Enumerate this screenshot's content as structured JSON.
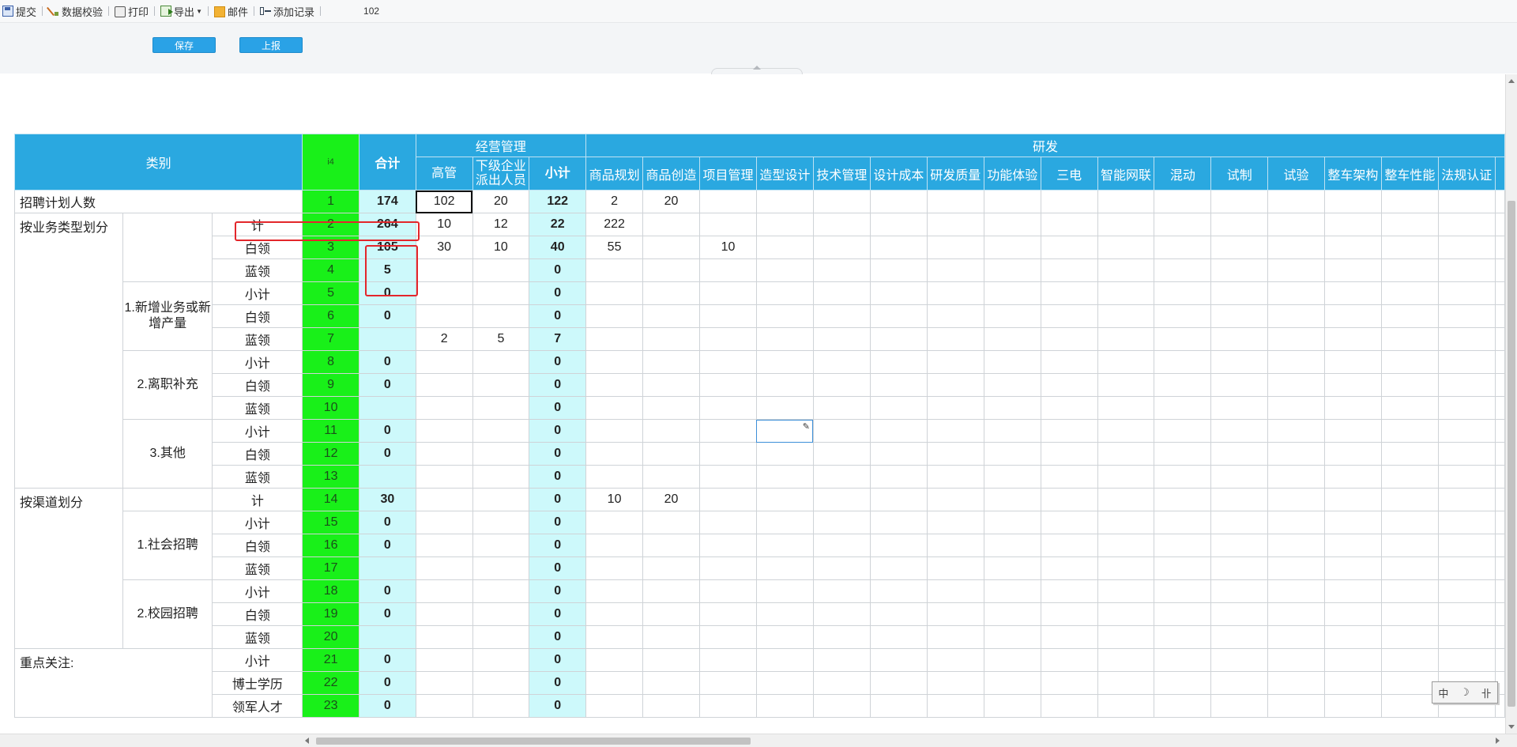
{
  "toolbar": {
    "submit": "提交",
    "validate": "数据校验",
    "print": "打印",
    "export": "导出",
    "mail": "邮件",
    "add_record": "添加记录",
    "record_no": "102"
  },
  "actions": {
    "save": "保存",
    "report": "上报"
  },
  "header": {
    "category": "类别",
    "rowid": "i4",
    "total": "合计",
    "group_mgmt": "经营管理",
    "group_rd": "研发",
    "mgmt_cols": [
      "高管",
      "下级企业派出人员",
      "小计"
    ],
    "rd_cols": [
      "商品规划",
      "商品创造",
      "项目管理",
      "造型设计",
      "技术管理",
      "设计成本",
      "研发质量",
      "功能体验",
      "三电",
      "智能网联",
      "混动",
      "试制",
      "试验",
      "整车架构",
      "整车性能",
      "法规认证"
    ]
  },
  "sections": {
    "plan": "招聘计划人数",
    "by_type": "按业务类型划分",
    "new_biz": "1.新增业务或新增产量",
    "attrition": "2.离职补充",
    "other": "3.其他",
    "by_channel": "按渠道划分",
    "social": "1.社会招聘",
    "campus": "2.校园招聘",
    "focus": "重点关注:"
  },
  "rows": [
    {
      "label": "",
      "no": "1",
      "total": "174",
      "gg": "102",
      "xj": "20",
      "sub": "122",
      "rd": [
        "2",
        "20",
        "",
        "",
        "",
        "",
        "",
        "",
        "",
        "",
        "",
        "",
        "",
        "",
        "",
        ""
      ]
    },
    {
      "label": "计",
      "no": "2",
      "total": "264",
      "gg": "10",
      "xj": "12",
      "sub": "22",
      "rd": [
        "222",
        "",
        "",
        "",
        "",
        "",
        "",
        "",
        "",
        "",
        "",
        "",
        "",
        "",
        "",
        ""
      ]
    },
    {
      "label": "白领",
      "no": "3",
      "total": "105",
      "gg": "30",
      "xj": "10",
      "sub": "40",
      "rd": [
        "55",
        "",
        "10",
        "",
        "",
        "",
        "",
        "",
        "",
        "",
        "",
        "",
        "",
        "",
        "",
        ""
      ]
    },
    {
      "label": "蓝领",
      "no": "4",
      "total": "5",
      "gg": "",
      "xj": "",
      "sub": "0",
      "rd": [
        "",
        "",
        "",
        "",
        "",
        "",
        "",
        "",
        "",
        "",
        "",
        "",
        "",
        "",
        "",
        ""
      ]
    },
    {
      "label": "小计",
      "no": "5",
      "total": "0",
      "gg": "",
      "xj": "",
      "sub": "0",
      "rd": [
        "",
        "",
        "",
        "",
        "",
        "",
        "",
        "",
        "",
        "",
        "",
        "",
        "",
        "",
        "",
        ""
      ]
    },
    {
      "label": "白领",
      "no": "6",
      "total": "0",
      "gg": "",
      "xj": "",
      "sub": "0",
      "rd": [
        "",
        "",
        "",
        "",
        "",
        "",
        "",
        "",
        "",
        "",
        "",
        "",
        "",
        "",
        "",
        ""
      ]
    },
    {
      "label": "蓝领",
      "no": "7",
      "total": "",
      "gg": "2",
      "xj": "5",
      "sub": "7",
      "rd": [
        "",
        "",
        "",
        "",
        "",
        "",
        "",
        "",
        "",
        "",
        "",
        "",
        "",
        "",
        "",
        ""
      ]
    },
    {
      "label": "小计",
      "no": "8",
      "total": "0",
      "gg": "",
      "xj": "",
      "sub": "0",
      "rd": [
        "",
        "",
        "",
        "",
        "",
        "",
        "",
        "",
        "",
        "",
        "",
        "",
        "",
        "",
        "",
        ""
      ]
    },
    {
      "label": "白领",
      "no": "9",
      "total": "0",
      "gg": "",
      "xj": "",
      "sub": "0",
      "rd": [
        "",
        "",
        "",
        "",
        "",
        "",
        "",
        "",
        "",
        "",
        "",
        "",
        "",
        "",
        "",
        ""
      ]
    },
    {
      "label": "蓝领",
      "no": "10",
      "total": "",
      "gg": "",
      "xj": "",
      "sub": "0",
      "rd": [
        "",
        "",
        "",
        "",
        "",
        "",
        "",
        "",
        "",
        "",
        "",
        "",
        "",
        "",
        "",
        ""
      ]
    },
    {
      "label": "小计",
      "no": "11",
      "total": "0",
      "gg": "",
      "xj": "",
      "sub": "0",
      "rd": [
        "",
        "",
        "",
        "",
        "",
        "",
        "",
        "",
        "",
        "",
        "",
        "",
        "",
        "",
        "",
        ""
      ]
    },
    {
      "label": "白领",
      "no": "12",
      "total": "0",
      "gg": "",
      "xj": "",
      "sub": "0",
      "rd": [
        "",
        "",
        "",
        "",
        "",
        "",
        "",
        "",
        "",
        "",
        "",
        "",
        "",
        "",
        "",
        ""
      ]
    },
    {
      "label": "蓝领",
      "no": "13",
      "total": "",
      "gg": "",
      "xj": "",
      "sub": "0",
      "rd": [
        "",
        "",
        "",
        "",
        "",
        "",
        "",
        "",
        "",
        "",
        "",
        "",
        "",
        "",
        "",
        ""
      ]
    },
    {
      "label": "计",
      "no": "14",
      "total": "30",
      "gg": "",
      "xj": "",
      "sub": "0",
      "rd": [
        "10",
        "20",
        "",
        "",
        "",
        "",
        "",
        "",
        "",
        "",
        "",
        "",
        "",
        "",
        "",
        ""
      ]
    },
    {
      "label": "小计",
      "no": "15",
      "total": "0",
      "gg": "",
      "xj": "",
      "sub": "0",
      "rd": [
        "",
        "",
        "",
        "",
        "",
        "",
        "",
        "",
        "",
        "",
        "",
        "",
        "",
        "",
        "",
        ""
      ]
    },
    {
      "label": "白领",
      "no": "16",
      "total": "0",
      "gg": "",
      "xj": "",
      "sub": "0",
      "rd": [
        "",
        "",
        "",
        "",
        "",
        "",
        "",
        "",
        "",
        "",
        "",
        "",
        "",
        "",
        "",
        ""
      ]
    },
    {
      "label": "蓝领",
      "no": "17",
      "total": "",
      "gg": "",
      "xj": "",
      "sub": "0",
      "rd": [
        "",
        "",
        "",
        "",
        "",
        "",
        "",
        "",
        "",
        "",
        "",
        "",
        "",
        "",
        "",
        ""
      ]
    },
    {
      "label": "小计",
      "no": "18",
      "total": "0",
      "gg": "",
      "xj": "",
      "sub": "0",
      "rd": [
        "",
        "",
        "",
        "",
        "",
        "",
        "",
        "",
        "",
        "",
        "",
        "",
        "",
        "",
        "",
        ""
      ]
    },
    {
      "label": "白领",
      "no": "19",
      "total": "0",
      "gg": "",
      "xj": "",
      "sub": "0",
      "rd": [
        "",
        "",
        "",
        "",
        "",
        "",
        "",
        "",
        "",
        "",
        "",
        "",
        "",
        "",
        "",
        ""
      ]
    },
    {
      "label": "蓝领",
      "no": "20",
      "total": "",
      "gg": "",
      "xj": "",
      "sub": "0",
      "rd": [
        "",
        "",
        "",
        "",
        "",
        "",
        "",
        "",
        "",
        "",
        "",
        "",
        "",
        "",
        "",
        ""
      ]
    },
    {
      "label": "小计",
      "no": "21",
      "total": "0",
      "gg": "",
      "xj": "",
      "sub": "0",
      "rd": [
        "",
        "",
        "",
        "",
        "",
        "",
        "",
        "",
        "",
        "",
        "",
        "",
        "",
        "",
        "",
        ""
      ]
    },
    {
      "label": "博士学历",
      "no": "22",
      "total": "0",
      "gg": "",
      "xj": "",
      "sub": "0",
      "rd": [
        "",
        "",
        "",
        "",
        "",
        "",
        "",
        "",
        "",
        "",
        "",
        "",
        "",
        "",
        "",
        ""
      ]
    },
    {
      "label": "领军人才",
      "no": "23",
      "total": "0",
      "gg": "",
      "xj": "",
      "sub": "0",
      "rd": [
        "",
        "",
        "",
        "",
        "",
        "",
        "",
        "",
        "",
        "",
        "",
        "",
        "",
        "",
        "",
        ""
      ]
    }
  ],
  "ime": {
    "lang": "中",
    "moon": "☽",
    "punct": "卝"
  }
}
